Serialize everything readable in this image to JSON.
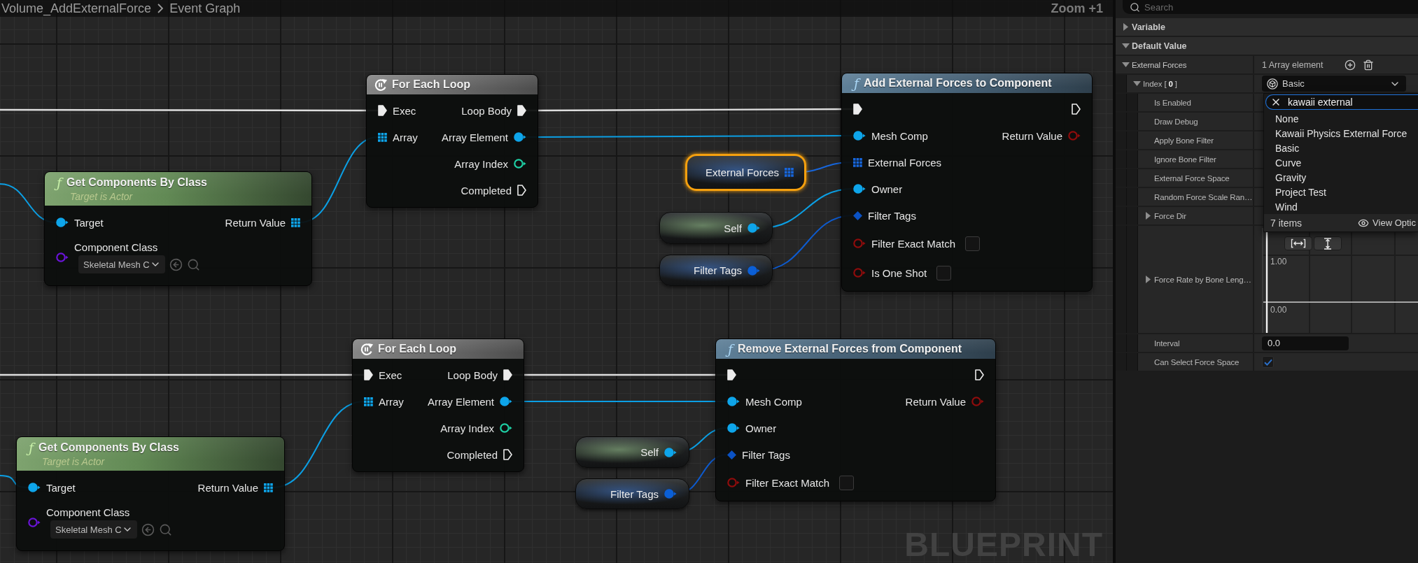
{
  "graph": {
    "breadcrumb": [
      {
        "label": "Volume_AddExternalForce"
      },
      {
        "label": "Event Graph"
      }
    ],
    "zoom_label": "Zoom +1",
    "corner_label": "BLUEPRINT",
    "nodes": [
      {
        "kind": "macro",
        "title": "For Each Loop",
        "inputs": [
          {
            "kind": "exec",
            "label": "Exec",
            "connected": true
          },
          {
            "kind": "object_array",
            "label": "Array",
            "connected": true
          }
        ],
        "outputs": [
          {
            "kind": "exec",
            "label": "Loop Body",
            "connected": true
          },
          {
            "kind": "object",
            "label": "Array Element",
            "connected": true
          },
          {
            "kind": "int",
            "label": "Array Index",
            "connected": false
          },
          {
            "kind": "exec",
            "label": "Completed",
            "connected": false
          }
        ]
      },
      {
        "kind": "pure_function",
        "glyph": "ƒ",
        "title": "Get Components By Class",
        "subtitle": "Target is Actor",
        "inputs": [
          {
            "kind": "object",
            "label": "Target",
            "connected": true
          },
          {
            "kind": "class",
            "label": "Component Class",
            "connected": false,
            "value": "Skeletal Mesh C"
          }
        ],
        "outputs": [
          {
            "kind": "object_array",
            "label": "Return Value",
            "connected": true
          }
        ]
      },
      {
        "kind": "function",
        "glyph": "ƒ",
        "title": "Add External Forces to Component",
        "inputs": [
          {
            "kind": "exec",
            "connected": true
          },
          {
            "kind": "object",
            "label": "Mesh Comp",
            "connected": true
          },
          {
            "kind": "struct_array",
            "label": "External Forces",
            "connected": true
          },
          {
            "kind": "object",
            "label": "Owner",
            "connected": true
          },
          {
            "kind": "struct_ref",
            "label": "Filter Tags",
            "connected": true
          },
          {
            "kind": "bool",
            "label": "Filter Exact Match",
            "connected": false,
            "checked": false
          },
          {
            "kind": "bool",
            "label": "Is One Shot",
            "connected": false,
            "checked": false
          }
        ],
        "outputs": [
          {
            "kind": "exec",
            "connected": false
          },
          {
            "kind": "bool",
            "label": "Return Value",
            "connected": false
          }
        ]
      },
      {
        "kind": "macro",
        "title": "For Each Loop",
        "inputs": [
          {
            "kind": "exec",
            "label": "Exec",
            "connected": true
          },
          {
            "kind": "object_array",
            "label": "Array",
            "connected": true
          }
        ],
        "outputs": [
          {
            "kind": "exec",
            "label": "Loop Body",
            "connected": true
          },
          {
            "kind": "object",
            "label": "Array Element",
            "connected": true
          },
          {
            "kind": "int",
            "label": "Array Index",
            "connected": false
          },
          {
            "kind": "exec",
            "label": "Completed",
            "connected": false
          }
        ]
      },
      {
        "kind": "pure_function",
        "glyph": "ƒ",
        "title": "Get Components By Class",
        "subtitle": "Target is Actor",
        "inputs": [
          {
            "kind": "object",
            "label": "Target",
            "connected": true
          },
          {
            "kind": "class",
            "label": "Component Class",
            "connected": false,
            "value": "Skeletal Mesh C"
          }
        ],
        "outputs": [
          {
            "kind": "object_array",
            "label": "Return Value",
            "connected": true
          }
        ]
      },
      {
        "kind": "function",
        "glyph": "ƒ",
        "title": "Remove External Forces from Component",
        "inputs": [
          {
            "kind": "exec",
            "connected": true
          },
          {
            "kind": "object",
            "label": "Mesh Comp",
            "connected": true
          },
          {
            "kind": "object",
            "label": "Owner",
            "connected": true
          },
          {
            "kind": "struct_ref",
            "label": "Filter Tags",
            "connected": true
          },
          {
            "kind": "bool",
            "label": "Filter Exact Match",
            "connected": false,
            "checked": false
          }
        ],
        "outputs": [
          {
            "kind": "exec",
            "connected": false
          },
          {
            "kind": "bool",
            "label": "Return Value",
            "connected": false
          }
        ]
      }
    ],
    "variables": [
      {
        "kind": "variable",
        "label": "External Forces",
        "selected": true,
        "pin": {
          "kind": "struct_array",
          "connected": true
        }
      },
      {
        "kind": "self",
        "label": "Self",
        "selected": false,
        "pin": {
          "kind": "object",
          "connected": true
        }
      },
      {
        "kind": "variable",
        "label": "Filter Tags",
        "selected": false,
        "pin": {
          "kind": "struct",
          "connected": true
        }
      },
      {
        "kind": "self",
        "label": "Self",
        "selected": false,
        "pin": {
          "kind": "object",
          "connected": true
        }
      },
      {
        "kind": "variable",
        "label": "Filter Tags",
        "selected": false,
        "pin": {
          "kind": "struct",
          "connected": true
        }
      }
    ]
  },
  "details": {
    "search": {
      "placeholder": "Search"
    },
    "sections": [
      {
        "label": "Variable",
        "expanded": false
      },
      {
        "label": "Default Value",
        "expanded": true,
        "properties": [
          {
            "kind": "array",
            "label": "External Forces",
            "expanded": true,
            "value": "1 Array element",
            "children": [
              {
                "kind": "instanced",
                "label": "Index [ **0** ]",
                "expanded": true,
                "value": "Basic",
                "children": [
                  {
                    "kind": "plain",
                    "label": "Is Enabled"
                  },
                  {
                    "kind": "plain",
                    "label": "Draw Debug"
                  },
                  {
                    "kind": "plain",
                    "label": "Apply Bone Filter"
                  },
                  {
                    "kind": "plain",
                    "label": "Ignore Bone Filter"
                  },
                  {
                    "kind": "plain",
                    "label": "External Force Space"
                  },
                  {
                    "kind": "plain",
                    "label": "Random Force Scale Ran…"
                  },
                  {
                    "kind": "group",
                    "label": "Force Dir",
                    "expanded": false
                  },
                  {
                    "kind": "curve",
                    "label": "Force Rate by Bone Leng…",
                    "expanded": false,
                    "y_labels": [
                      "1.00",
                      "0.00"
                    ]
                  },
                  {
                    "kind": "number",
                    "label": "Interval",
                    "value": "0.0"
                  },
                  {
                    "kind": "checkbox",
                    "label": "Can Select Force Space",
                    "checked": true
                  }
                ]
              }
            ]
          }
        ]
      }
    ],
    "type_menu": {
      "search_value": "kawaii external",
      "items": [
        {
          "label": "None",
          "selected": false
        },
        {
          "label": "Kawaii Physics External Force",
          "selected": false
        },
        {
          "label": "Basic",
          "selected": false
        },
        {
          "label": "Curve",
          "selected": false
        },
        {
          "label": "Gravity",
          "selected": false
        },
        {
          "label": "Project Test",
          "selected": false
        },
        {
          "label": "Wind",
          "selected": false
        }
      ],
      "count": "7 items",
      "view_options": "View Optic"
    }
  }
}
